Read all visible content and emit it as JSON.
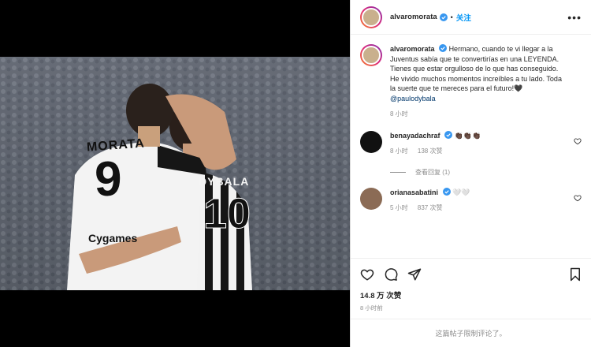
{
  "header": {
    "username": "alvaromorata",
    "follow_label": "关注",
    "more": "•••"
  },
  "caption": {
    "username": "alvaromorata",
    "text": "Hermano, cuando te vi llegar a la Juventus sabía que te convertirías en una LEYENDA. Tienes que estar orgulloso de lo que has conseguido. He vivido muchos momentos increíbles a tu lado. Toda la suerte que te mereces para el futuro!🖤",
    "mention": "@paulodybala",
    "time": "8 小时"
  },
  "comments": [
    {
      "username": "benayadachraf",
      "text": "👏🏿👏🏿👏🏿",
      "time": "8 小时",
      "likes": "138 次赞",
      "replies": "查看回复 (1)"
    },
    {
      "username": "orianasabatini",
      "text": "🤍🤍",
      "time": "5 小时",
      "likes": "837 次赞"
    }
  ],
  "likes_count": "14.8 万 次赞",
  "post_time": "8 小时前",
  "comments_disabled": "这篇帖子限制评论了。",
  "jersey": {
    "left_name": "MORATA",
    "left_number": "9",
    "right_name": "DYBALA",
    "right_number": "10",
    "sponsor": "Cygames"
  },
  "colors": {
    "accent": "#0095f6",
    "verified": "#3897f0",
    "muted": "#8e8e8e",
    "mention": "#00376b"
  }
}
